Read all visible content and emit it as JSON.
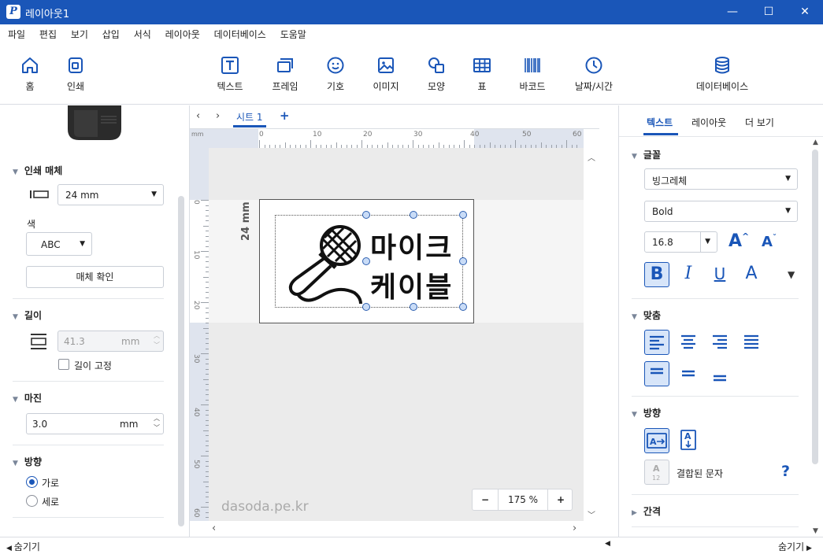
{
  "window": {
    "title": "레이아웃1",
    "minimize": "—",
    "maximize": "☐",
    "close": "✕"
  },
  "menu": [
    "파일",
    "편집",
    "보기",
    "삽입",
    "서식",
    "레이아웃",
    "데이터베이스",
    "도움말"
  ],
  "ribbon": {
    "home": "홈",
    "print": "인쇄",
    "text": "텍스트",
    "frame": "프레임",
    "symbol": "기호",
    "image": "이미지",
    "shape": "모양",
    "table": "표",
    "barcode": "바코드",
    "datetime": "날짜/시간",
    "database": "데이터베이스"
  },
  "left": {
    "media_section": "인쇄 매체",
    "media_size": "24 mm",
    "color_label": "색",
    "color_value": "ABC",
    "media_check": "매체 확인",
    "length_section": "길이",
    "length_value": "41.3",
    "length_unit": "mm",
    "length_fixed": "길이 고정",
    "margin_section": "마진",
    "margin_value": "3.0",
    "margin_unit": "mm",
    "direction_section": "방향",
    "horizontal": "가로",
    "vertical": "세로"
  },
  "center": {
    "sheet_tab": "시트 1",
    "add_sheet": "+",
    "ruler_unit": "mm",
    "ruler_top": [
      "0",
      "10",
      "20",
      "30",
      "40",
      "50",
      "60"
    ],
    "ruler_left": [
      "0",
      "10",
      "20",
      "30",
      "40",
      "50",
      "60"
    ],
    "tape_width_label": "24 mm",
    "label_line1": "마이크",
    "label_line2": "케이블",
    "zoom": "175 %",
    "zoom_minus": "−",
    "zoom_plus": "+",
    "watermark": "dasoda.pe.kr"
  },
  "right": {
    "tab_text": "텍스트",
    "tab_layout": "레이아웃",
    "tab_more": "더 보기",
    "font_section": "글꼴",
    "font_name": "빙그레체",
    "font_style": "Bold",
    "font_size": "16.8",
    "align_section": "맞춤",
    "direction_section": "방향",
    "combined_chars": "결합된 문자",
    "spacing_section": "간격"
  },
  "bottom": {
    "hide_left": "숨기기",
    "hide_right": "숨기기"
  },
  "colors": {
    "accent": "#1a56b8",
    "selected_bg": "#d7e5f9"
  }
}
